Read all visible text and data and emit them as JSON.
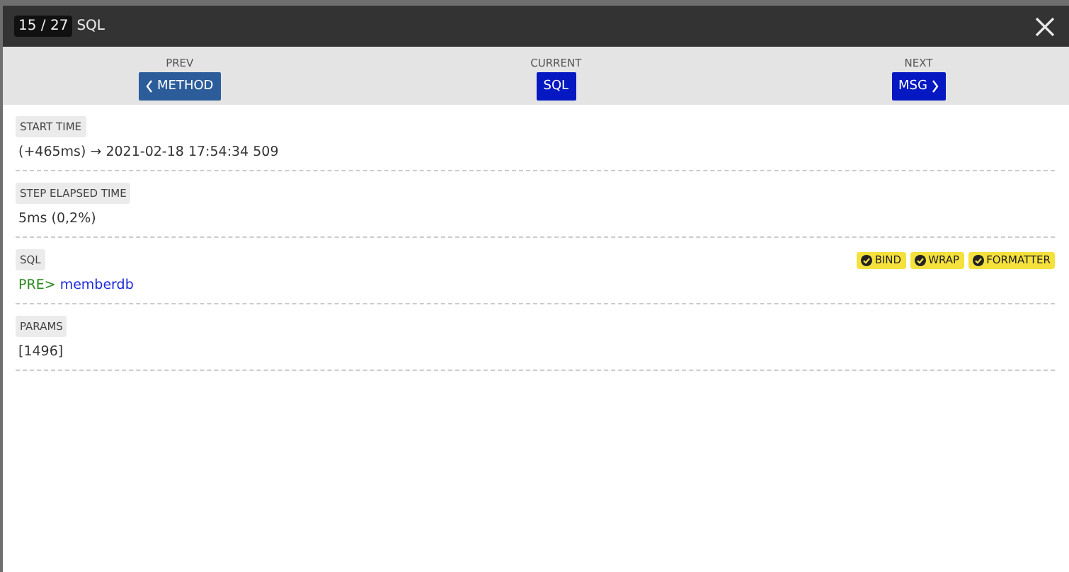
{
  "header": {
    "counter": "15 / 27",
    "title": "SQL"
  },
  "nav": [
    {
      "kind": "prev",
      "label": "PREV",
      "button": "METHOD"
    },
    {
      "kind": "current",
      "label": "CURRENT",
      "button": "SQL"
    },
    {
      "kind": "next",
      "label": "NEXT",
      "button": "MSG"
    }
  ],
  "sections": [
    {
      "label": "START TIME",
      "value": "(+465ms) → 2021-02-18 17:54:34 509"
    },
    {
      "label": "STEP ELAPSED TIME",
      "value": "5ms (0,2%)"
    },
    {
      "label": "SQL",
      "prefix": "PRE>",
      "value": "memberdb",
      "options": [
        {
          "label": "BIND",
          "checked": true
        },
        {
          "label": "WRAP",
          "checked": true
        },
        {
          "label": "FORMATTER",
          "checked": true
        }
      ]
    },
    {
      "label": "PARAMS",
      "value": "[1496]"
    }
  ]
}
